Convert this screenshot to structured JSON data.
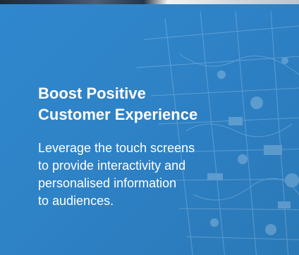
{
  "section": {
    "heading_line1": "Boost Positive",
    "heading_line2": "Customer Experience",
    "body_line1": "Leverage the touch screens",
    "body_line2": "to provide interactivity and",
    "body_line3": "personalised information",
    "body_line4": "to audiences."
  },
  "colors": {
    "overlay": "#2f86cc",
    "text": "#ffffff"
  }
}
